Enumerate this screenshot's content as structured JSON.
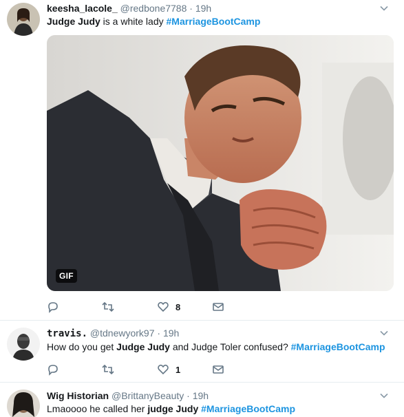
{
  "tweets": [
    {
      "fullname": "keesha_lacole_",
      "username": "@redbone7788",
      "dot": "·",
      "time": "19h",
      "text_parts": {
        "bold": "Judge Judy",
        "plain": " is a white lady ",
        "hashtag": "#MarriageBootCamp"
      },
      "media": {
        "badge": "GIF"
      },
      "actions": {
        "reply": "",
        "retweet": "",
        "like": "8",
        "message": ""
      }
    },
    {
      "fullname": "travis.",
      "username": "@tdnewyork97",
      "dot": "·",
      "time": "19h",
      "text_parts": {
        "plain1": "How do you get ",
        "bold": "Judge Judy",
        "plain2": " and Judge Toler confused? ",
        "hashtag": "#MarriageBootCamp"
      },
      "actions": {
        "reply": "",
        "retweet": "",
        "like": "1",
        "message": ""
      }
    },
    {
      "fullname": "Wig Historian",
      "username": "@BrittanyBeauty",
      "dot": "·",
      "time": "19h",
      "text_parts": {
        "plain": "Lmaoooo he called her ",
        "bold": "judge Judy",
        "space": " ",
        "hashtag": "#MarriageBootCamp"
      }
    }
  ],
  "colors": {
    "accent": "#1c94e0",
    "muted": "#657786",
    "divider": "#e6ecf0"
  },
  "icons": [
    "chevron-down-icon",
    "reply-icon",
    "retweet-icon",
    "like-icon",
    "message-icon"
  ]
}
